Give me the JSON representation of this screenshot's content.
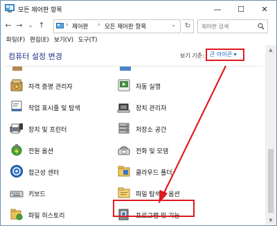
{
  "window": {
    "title": "모든 제어판 항목",
    "minimize": "—",
    "maximize": "☐",
    "close": "✕"
  },
  "nav": {
    "back": "←",
    "forward": "→",
    "history": "⌄",
    "up": "↑",
    "breadcrumb": [
      "제어판",
      "모든 제어판 항목"
    ],
    "sep": "›",
    "dropdown": "⌄",
    "refresh": "↻"
  },
  "search": {
    "placeholder": "제어판 검색"
  },
  "menu": [
    "파일(F)",
    "편집(E)",
    "보기(V)",
    "도구(T)"
  ],
  "content": {
    "heading": "컴퓨터 설정 변경",
    "view_by_label": "보기 기준:",
    "view_by_value": "큰 아이콘 ▾"
  },
  "items": {
    "left": [
      {
        "label": "자격 증명 관리자",
        "icon": "credential-manager-icon"
      },
      {
        "label": "작업 표시줄 및 탐색",
        "icon": "taskbar-icon"
      },
      {
        "label": "장치 및 프린터",
        "icon": "printer-icon"
      },
      {
        "label": "전원 옵션",
        "icon": "power-options-icon"
      },
      {
        "label": "접근성 센터",
        "icon": "accessibility-icon"
      },
      {
        "label": "키보드",
        "icon": "keyboard-icon"
      },
      {
        "label": "파일 히스토리",
        "icon": "file-history-icon"
      }
    ],
    "right": [
      {
        "label": "자동 실행",
        "icon": "autoplay-icon"
      },
      {
        "label": "장치 관리자",
        "icon": "device-manager-icon"
      },
      {
        "label": "저장소 공간",
        "icon": "storage-spaces-icon"
      },
      {
        "label": "전화 및 모뎀",
        "icon": "phone-modem-icon"
      },
      {
        "label": "클라우드 폴더",
        "icon": "work-folders-icon"
      },
      {
        "label": "파일 탐색기 옵션",
        "icon": "explorer-options-icon"
      },
      {
        "label": "프로그램 및 기능",
        "icon": "programs-features-icon"
      }
    ]
  },
  "colors": {
    "accent_red": "#e0191f",
    "heading_blue": "#1e3287",
    "link_blue": "#1a56b8"
  }
}
